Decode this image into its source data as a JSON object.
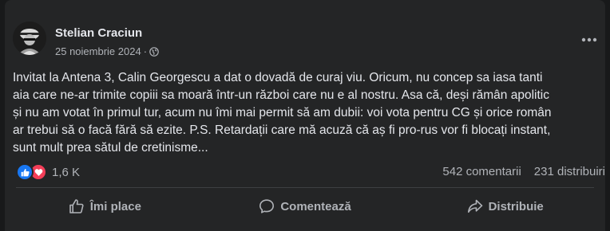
{
  "post": {
    "author": "Stelian Craciun",
    "date": "25 noiembrie 2024",
    "separator": "·",
    "privacy_icon": "globe-icon",
    "more_icon": "more-horizontal-icon",
    "body_lines": [
      "Invitat la Antena 3, Calin Georgescu a dat o dovadă de curaj viu.  Oricum, nu concep sa iasa tanti",
      "aia care ne-ar trimite copiii sa moară într-un război care nu e al nostru. Asa că, deși rămân apolitic",
      "și nu am votat în primul tur, acum nu îmi mai permit să am dubii: voi vota pentru CG și orice român",
      "ar trebui să o facă fără să ezite. P.S. Retardații care mă acuză că aș fi pro-rus vor fi blocați instant,",
      "sunt mult prea sătul de cretinisme..."
    ]
  },
  "engagement": {
    "reactions_count": "1,6 K",
    "reaction_icons": [
      "like-icon",
      "love-icon"
    ],
    "comments": "542 comentarii",
    "shares": "231 distribuiri"
  },
  "actions": {
    "like": "Îmi place",
    "comment": "Comentează",
    "share": "Distribuie"
  },
  "colors": {
    "background": "#18191a",
    "card": "#242526",
    "text_primary": "#e4e6eb",
    "text_secondary": "#b0b3b8",
    "like_blue": "#1877f2",
    "love_red": "#f33e58",
    "divider": "#3e4042"
  }
}
